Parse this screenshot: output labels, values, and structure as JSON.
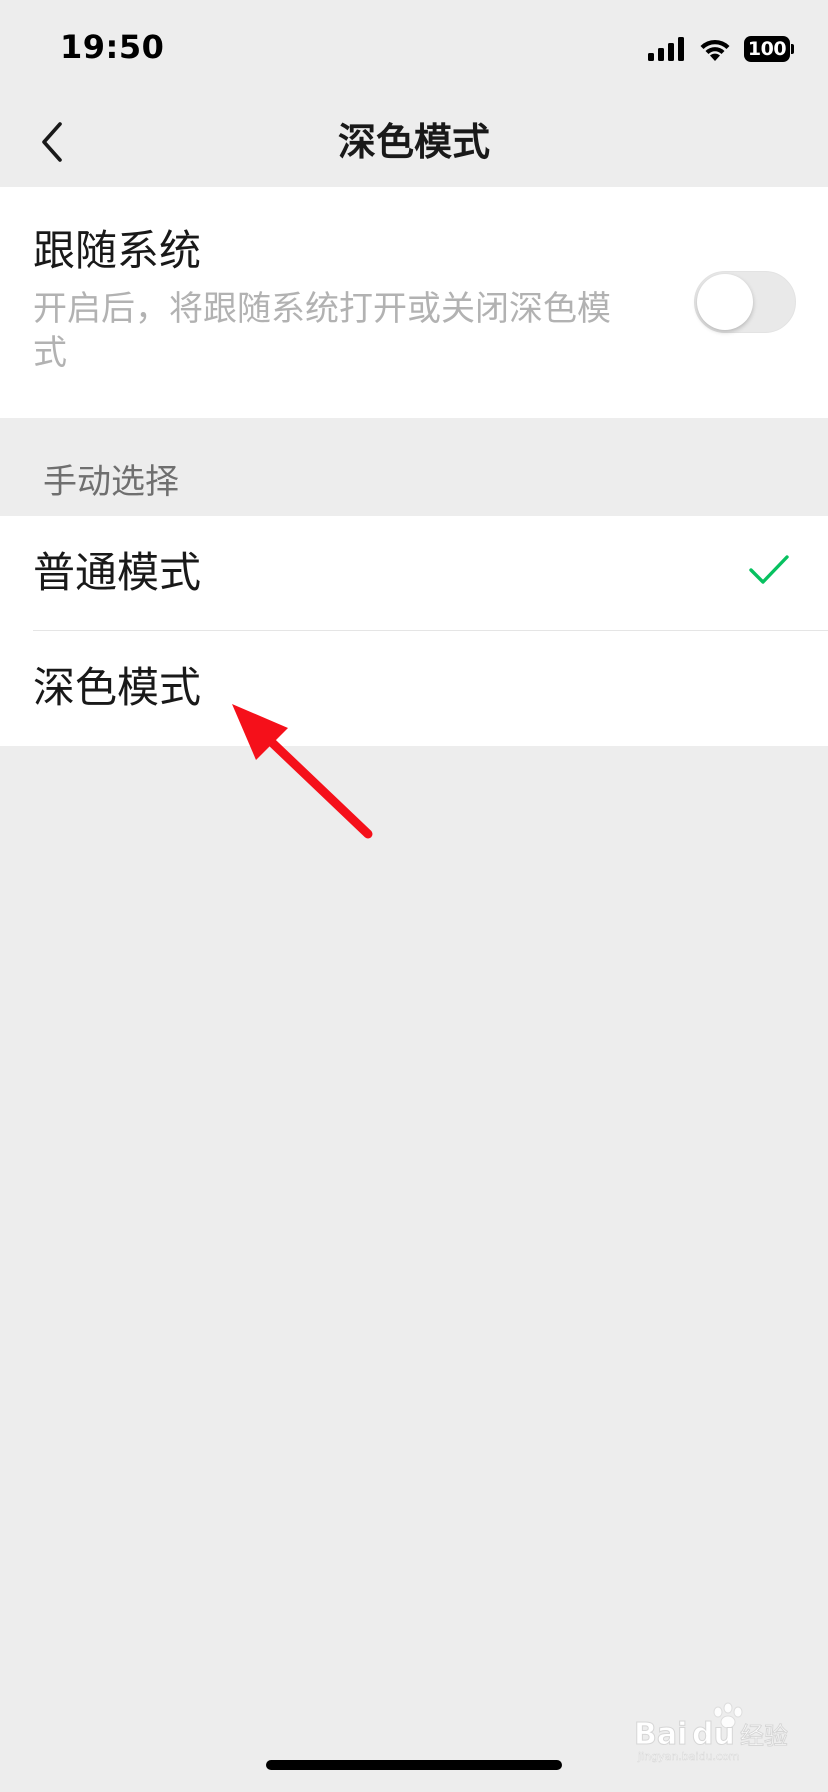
{
  "status_bar": {
    "time": "19:50",
    "battery_level": "100",
    "icons": [
      "signal-icon",
      "wifi-icon",
      "battery-icon"
    ]
  },
  "nav": {
    "title": "深色模式",
    "back_icon": "chevron-left-icon"
  },
  "follow_system": {
    "title": "跟随系统",
    "description": "开启后，将跟随系统打开或关闭深色模式",
    "toggle_on": false
  },
  "manual": {
    "section_title": "手动选择",
    "options": [
      {
        "label": "普通模式",
        "selected": true
      },
      {
        "label": "深色模式",
        "selected": false
      }
    ]
  },
  "watermark": {
    "text": "Baidu经验",
    "subtext": "jingyan.baidu.com"
  },
  "colors": {
    "background": "#ededed",
    "card": "#ffffff",
    "check": "#07c160",
    "annotation_arrow": "#f5101a",
    "secondary_text": "#b2b2b2"
  }
}
